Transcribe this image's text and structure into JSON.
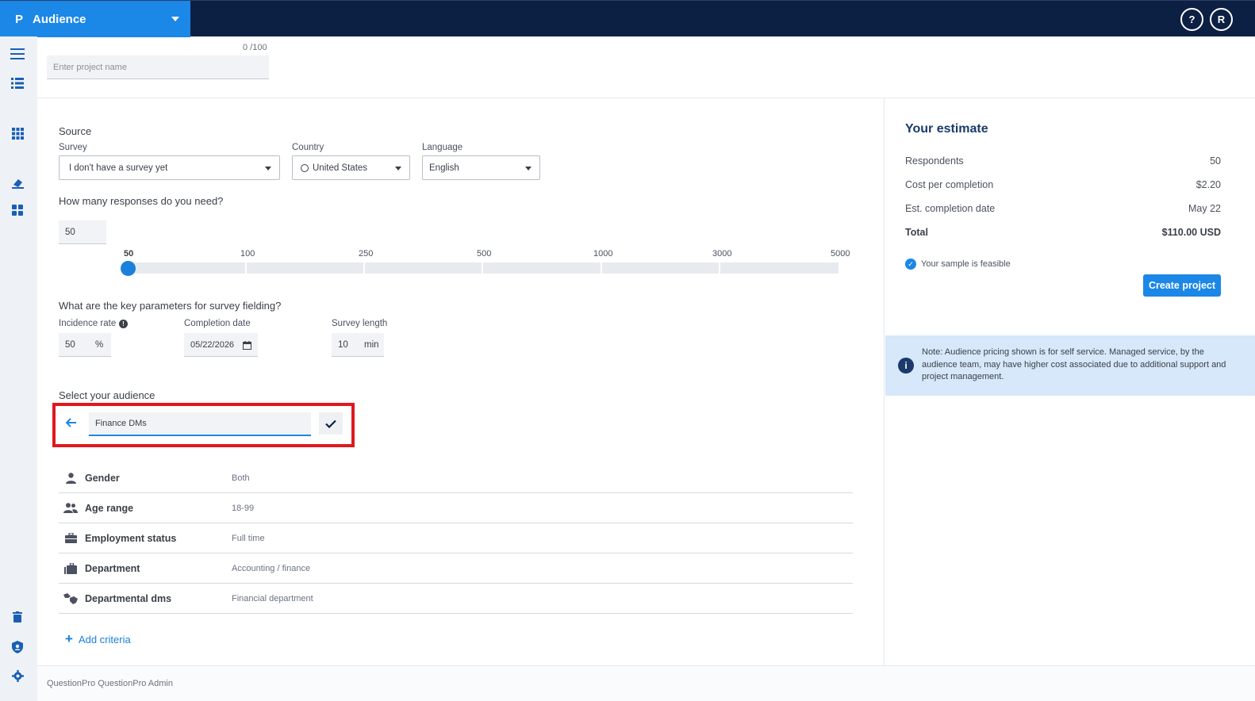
{
  "topbar": {
    "app_title": "Audience",
    "help_label": "?",
    "avatar_initial": "R"
  },
  "project": {
    "char_count": "0 /100",
    "placeholder": "Enter project name"
  },
  "source": {
    "section_title": "Source",
    "survey_label": "Survey",
    "survey_value": "I don't have a survey yet",
    "country_label": "Country",
    "country_value": "United States",
    "language_label": "Language",
    "language_value": "English"
  },
  "responses": {
    "question": "How many responses do you need?",
    "value": "50",
    "slider_marks": [
      "50",
      "100",
      "250",
      "500",
      "1000",
      "3000",
      "5000"
    ],
    "selected_mark": "50"
  },
  "parameters": {
    "question": "What are the key parameters for survey fielding?",
    "incidence_label": "Incidence rate",
    "incidence_value": "50",
    "incidence_unit": "%",
    "completion_label": "Completion date",
    "completion_value": "05/22/2026",
    "length_label": "Survey length",
    "length_value": "10",
    "length_unit": "min"
  },
  "audience": {
    "section_title": "Select your audience",
    "name_value": "Finance DMs",
    "criteria": [
      {
        "name": "Gender",
        "value": "Both",
        "icon": "person-icon"
      },
      {
        "name": "Age range",
        "value": "18-99",
        "icon": "people-icon"
      },
      {
        "name": "Employment status",
        "value": "Full time",
        "icon": "briefcase-icon"
      },
      {
        "name": "Department",
        "value": "Accounting / finance",
        "icon": "department-icon"
      },
      {
        "name": "Departmental dms",
        "value": "Financial department",
        "icon": "handshake-icon"
      }
    ],
    "add_criteria_label": "Add criteria"
  },
  "estimate": {
    "title": "Your estimate",
    "respondents_label": "Respondents",
    "respondents_value": "50",
    "cost_label": "Cost per completion",
    "cost_value": "$2.20",
    "date_label": "Est. completion date",
    "date_value": "May 22",
    "total_label": "Total",
    "total_value": "$110.00 USD",
    "feasible_text": "Your sample is feasible",
    "create_button": "Create project",
    "note": "Note: Audience pricing shown is for self service. Managed service, by the audience team, may have higher cost associated due to additional support and project management."
  },
  "footer": {
    "text": "QuestionPro QuestionPro Admin"
  },
  "colors": {
    "brand": "#1b87e6",
    "navy": "#0c2044",
    "highlight": "#e0181e"
  }
}
